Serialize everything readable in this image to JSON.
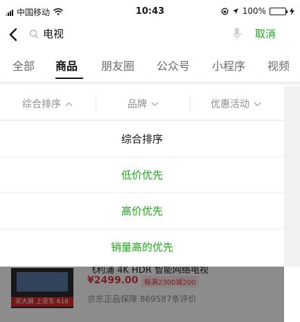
{
  "status_bar": {
    "carrier": "中国移动",
    "time": "10:43",
    "battery_percent": "100%",
    "battery_level": 1.0
  },
  "search": {
    "query": "电视",
    "cancel_label": "取消"
  },
  "tabs": [
    {
      "label": "全部",
      "active": false
    },
    {
      "label": "商品",
      "active": true
    },
    {
      "label": "朋友圈",
      "active": false
    },
    {
      "label": "公众号",
      "active": false
    },
    {
      "label": "小程序",
      "active": false
    },
    {
      "label": "视频",
      "active": false
    }
  ],
  "filters": [
    {
      "label": "综合排序",
      "expanded": true
    },
    {
      "label": "品牌",
      "expanded": false
    },
    {
      "label": "优惠活动",
      "expanded": false
    }
  ],
  "sort_options": [
    {
      "label": "综合排序",
      "selected": true
    },
    {
      "label": "低价优先",
      "selected": false
    },
    {
      "label": "高价优先",
      "selected": false
    },
    {
      "label": "销量高的优先",
      "selected": false
    }
  ],
  "product": {
    "title": "飞利浦 4K HDR 智能网络电视",
    "price": "¥2499.00",
    "promo": "每满2300减200",
    "guarantee": "京东正品保障",
    "reviews": "869587条评价",
    "image_tag": "买大屏 上京东 618"
  },
  "colors": {
    "accent_green": "#1aad19",
    "price_red": "#e4393c"
  }
}
